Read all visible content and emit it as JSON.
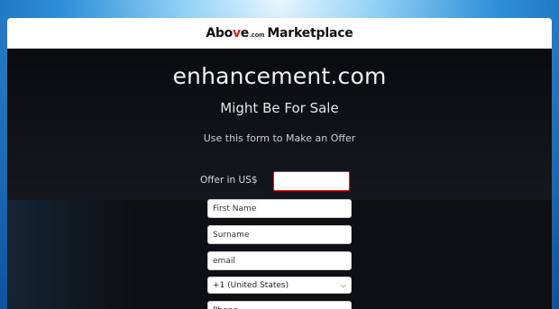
{
  "header": {
    "logo_above_prefix": "Abo",
    "logo_above_v": "v",
    "logo_above_suffix": "e",
    "logo_com": ".com",
    "logo_marketplace": "Marketplace"
  },
  "main": {
    "domain": "enhancement.com",
    "subtitle": "Might Be For Sale",
    "instruction": "Use this form to Make an Offer"
  },
  "form": {
    "offer_label": "Offer in US$",
    "offer_value": "",
    "first_name_placeholder": "First Name",
    "surname_placeholder": "Surname",
    "email_placeholder": "email",
    "country_code_selected": "+1 (United States)",
    "phone_placeholder": "Phone"
  },
  "colors": {
    "accent_red": "#d6242a",
    "panel_bg": "#0b0d10"
  }
}
